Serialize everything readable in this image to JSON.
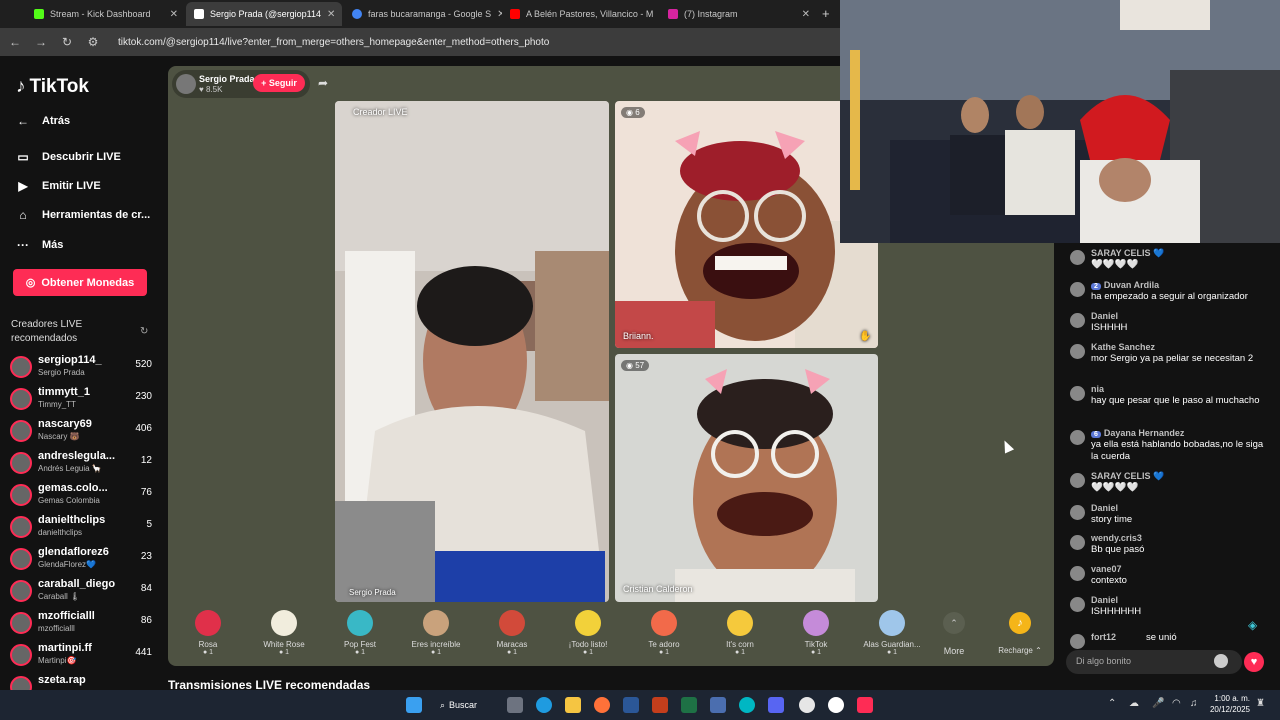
{
  "browser": {
    "tabs": [
      {
        "label": "Stream - Kick Dashboard",
        "color": "#53fc18"
      },
      {
        "label": "Sergio Prada (@sergiop114",
        "color": "#ffffff"
      },
      {
        "label": "faras bucaramanga - Google S",
        "color": "#4285f4"
      },
      {
        "label": "A Belén Pastores, Villancico - M",
        "color": "#ff0000"
      },
      {
        "label": "(7) Instagram",
        "color": "#d6249f"
      }
    ],
    "url": "tiktok.com/@sergiop114/live?enter_from_merge=others_homepage&enter_method=others_photo"
  },
  "sidebar": {
    "logo": "TikTok",
    "back": "Atrás",
    "nav": [
      {
        "label": "Descubrir LIVE",
        "icon": "tv-icon"
      },
      {
        "label": "Emitir LIVE",
        "icon": "camera-icon"
      },
      {
        "label": "Herramientas de cr...",
        "icon": "home-icon"
      },
      {
        "label": "Más",
        "icon": "more-icon"
      }
    ],
    "coins_button": "Obtener Monedas",
    "recommended_title": "Creadores LIVE recomendados",
    "creators": [
      {
        "user": "sergiop114_",
        "name": "Sergio Prada",
        "viewers": "520"
      },
      {
        "user": "timmytt_1",
        "name": "Timmy_TT",
        "viewers": "230"
      },
      {
        "user": "nascary69",
        "name": "Nascary 🐻",
        "viewers": "406"
      },
      {
        "user": "andreslegula...",
        "name": "Andrés Leguia 🦙",
        "viewers": "12"
      },
      {
        "user": "gemas.colo...",
        "name": "Gemas Colombia",
        "viewers": "76"
      },
      {
        "user": "danielthclips",
        "name": "danielthclips",
        "viewers": "5"
      },
      {
        "user": "glendaflorez6",
        "name": "GlendaFlorez💙",
        "viewers": "23"
      },
      {
        "user": "caraball_diego",
        "name": "Caraball 🌡",
        "viewers": "84"
      },
      {
        "user": "mzofficialll",
        "name": "mzofficialll",
        "viewers": "86"
      },
      {
        "user": "martinpi.ff",
        "name": "Martinpi🎯",
        "viewers": "441"
      },
      {
        "user": "szeta.rap",
        "name": "",
        "viewers": ""
      }
    ]
  },
  "live": {
    "host_name": "Sergio Prada",
    "host_likes": "♥ 8.5K",
    "follow": "+ Seguir",
    "main_badge": "Creador LIVE",
    "main_name": "Sergio Prada",
    "guest1_count": "6",
    "guest1_name": "Briiann.",
    "guest2_count": "57",
    "guest2_name": "Cristian Calderon"
  },
  "gifts": [
    {
      "name": "Rosa",
      "price": "1",
      "color": "#e0304a"
    },
    {
      "name": "White Rose",
      "price": "1",
      "color": "#f1eddd"
    },
    {
      "name": "Pop Fest",
      "price": "1",
      "color": "#39b8c6"
    },
    {
      "name": "Eres increíble",
      "price": "1",
      "color": "#c9a27c"
    },
    {
      "name": "Maracas",
      "price": "1",
      "color": "#d24a3a"
    },
    {
      "name": "¡Todo listo!",
      "price": "1",
      "color": "#f2d13a"
    },
    {
      "name": "Te adoro",
      "price": "1",
      "color": "#f26a4a"
    },
    {
      "name": "It's corn",
      "price": "1",
      "color": "#f5c93c"
    },
    {
      "name": "TikTok",
      "price": "1",
      "color": "#c58bd9"
    },
    {
      "name": "Alas Guardian...",
      "price": "1",
      "color": "#9fc6ea"
    }
  ],
  "gift_more": "More",
  "recharge": "Recharge ⌃",
  "recommended_heading": "Transmisiones LIVE recomendadas",
  "chat": [
    {
      "name": "SARAY CELIS 💙",
      "text": "🤍🤍🤍🤍",
      "level": ""
    },
    {
      "name": "Duvan Ardila",
      "text": "ha empezado a seguir al organizador",
      "level": "2"
    },
    {
      "name": "Daniel",
      "text": "ISHHHH",
      "level": ""
    },
    {
      "name": "Kathe Sanchez",
      "text": "mor Sergio ya pa peliar se necesitan 2",
      "level": ""
    },
    {
      "name": "nia",
      "text": "hay que pesar que le paso al muchacho",
      "level": ""
    },
    {
      "name": "Dayana Hernandez",
      "text": "ya ella está hablando bobadas,no le siga la cuerda",
      "level": "6"
    },
    {
      "name": "SARAY CELIS 💙",
      "text": "🤍🤍🤍🤍",
      "level": ""
    },
    {
      "name": "Daniel",
      "text": "story time",
      "level": ""
    },
    {
      "name": "wendy.cris3",
      "text": "Bb que pasó",
      "level": ""
    },
    {
      "name": "vane07",
      "text": "contexto",
      "level": ""
    },
    {
      "name": "Daniel",
      "text": "ISHHHHHH",
      "level": ""
    },
    {
      "name": "fort12",
      "text": "se unió",
      "level": ""
    }
  ],
  "chat_placeholder": "Di algo bonito",
  "taskbar": {
    "search": "Buscar",
    "time": "1:00 a. m.",
    "date": "20/12/2025"
  }
}
